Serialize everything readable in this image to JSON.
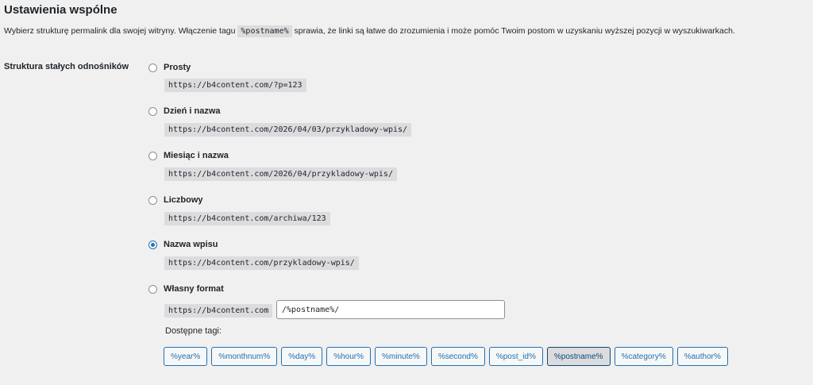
{
  "header": {
    "title": "Ustawienia wspólne"
  },
  "intro": {
    "before": "Wybierz strukturę permalink dla swojej witryny. Włączenie tagu ",
    "code": "%postname%",
    "after": " sprawia, że linki są łatwe do zrozumienia i może pomóc Twoim postom w uzyskaniu wyższej pozycji w wyszukiwarkach."
  },
  "permalinks": {
    "label": "Struktura stałych odnośników",
    "options": [
      {
        "label": "Prosty",
        "example": "https://b4content.com/?p=123",
        "selected": false
      },
      {
        "label": "Dzień i nazwa",
        "example": "https://b4content.com/2026/04/03/przykladowy-wpis/",
        "selected": false
      },
      {
        "label": "Miesiąc i nazwa",
        "example": "https://b4content.com/2026/04/przykladowy-wpis/",
        "selected": false
      },
      {
        "label": "Liczbowy",
        "example": "https://b4content.com/archiwa/123",
        "selected": false
      },
      {
        "label": "Nazwa wpisu",
        "example": "https://b4content.com/przykladowy-wpis/",
        "selected": true
      },
      {
        "label": "Własny format",
        "example": "https://b4content.com",
        "selected": false
      }
    ],
    "custom_value": "/%postname%/",
    "tags_label": "Dostępne tagi:",
    "tags": [
      "%year%",
      "%monthnum%",
      "%day%",
      "%hour%",
      "%minute%",
      "%second%",
      "%post_id%",
      "%postname%",
      "%category%",
      "%author%"
    ],
    "active_tag": "%postname%"
  },
  "colors": {
    "accent": "#2271b1",
    "background": "#f0f0f1",
    "code_bg": "#dcdcde"
  }
}
